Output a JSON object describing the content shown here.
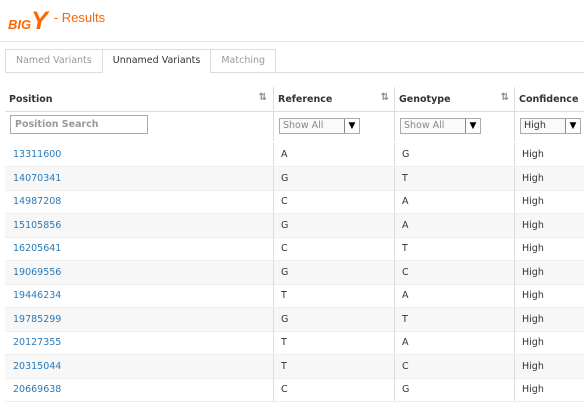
{
  "header": {
    "logo_big": "BIG",
    "logo_y": "Y",
    "title": "- Results"
  },
  "tabs": [
    {
      "label": "Named Variants"
    },
    {
      "label": "Unnamed Variants"
    },
    {
      "label": "Matching"
    }
  ],
  "table": {
    "columns": [
      "Position",
      "Reference",
      "Genotype",
      "Confidence"
    ],
    "filters": {
      "position_placeholder": "Position Search",
      "reference": "Show All",
      "genotype": "Show All",
      "confidence": "High"
    },
    "rows": [
      {
        "position": "13311600",
        "reference": "A",
        "genotype": "G",
        "confidence": "High"
      },
      {
        "position": "14070341",
        "reference": "G",
        "genotype": "T",
        "confidence": "High"
      },
      {
        "position": "14987208",
        "reference": "C",
        "genotype": "A",
        "confidence": "High"
      },
      {
        "position": "15105856",
        "reference": "G",
        "genotype": "A",
        "confidence": "High"
      },
      {
        "position": "16205641",
        "reference": "C",
        "genotype": "T",
        "confidence": "High"
      },
      {
        "position": "19069556",
        "reference": "G",
        "genotype": "C",
        "confidence": "High"
      },
      {
        "position": "19446234",
        "reference": "T",
        "genotype": "A",
        "confidence": "High"
      },
      {
        "position": "19785299",
        "reference": "G",
        "genotype": "T",
        "confidence": "High"
      },
      {
        "position": "20127355",
        "reference": "T",
        "genotype": "A",
        "confidence": "High"
      },
      {
        "position": "20315044",
        "reference": "T",
        "genotype": "C",
        "confidence": "High"
      },
      {
        "position": "20669638",
        "reference": "C",
        "genotype": "G",
        "confidence": "High"
      }
    ]
  },
  "colors": {
    "brand": "#ff6600",
    "link": "#2a7ab8"
  }
}
